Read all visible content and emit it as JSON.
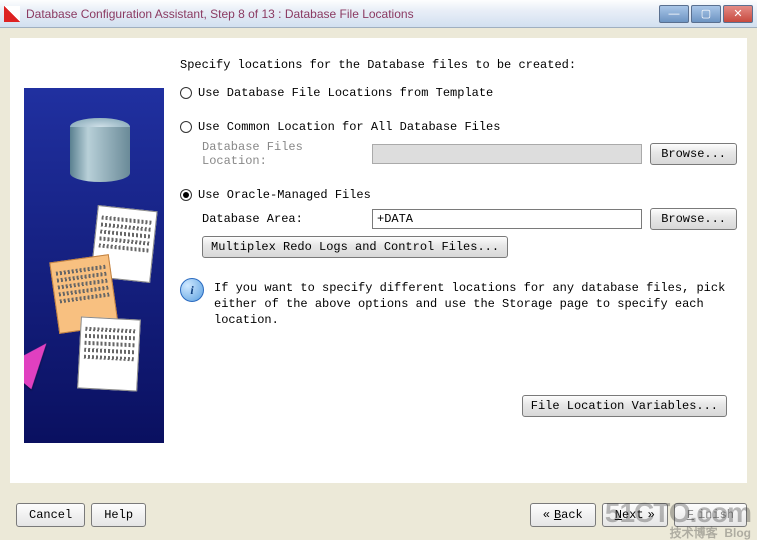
{
  "window": {
    "title": "Database Configuration Assistant, Step 8 of 13 : Database File Locations"
  },
  "heading": "Specify locations for the Database files to be created:",
  "options": {
    "template": {
      "label": "Use Database File Locations from Template",
      "selected": false
    },
    "common": {
      "label": "Use Common Location for All Database Files",
      "selected": false,
      "field_label": "Database Files Location:",
      "value": "",
      "browse": "Browse..."
    },
    "omf": {
      "label": "Use Oracle-Managed Files",
      "selected": true,
      "field_label": "Database Area:",
      "value": "+DATA",
      "browse": "Browse...",
      "multiplex": "Multiplex Redo Logs and Control Files..."
    }
  },
  "info": "If you want to specify different locations for any database files, pick either of the above options and use the Storage page to specify each location.",
  "file_loc_vars": "File Location Variables...",
  "buttons": {
    "cancel": "Cancel",
    "help": "Help",
    "back": "Back",
    "next": "Next",
    "finish": "Finish"
  },
  "watermark": {
    "site": "51CTO.com",
    "tag1": "技术博客",
    "tag2": "Blog"
  }
}
